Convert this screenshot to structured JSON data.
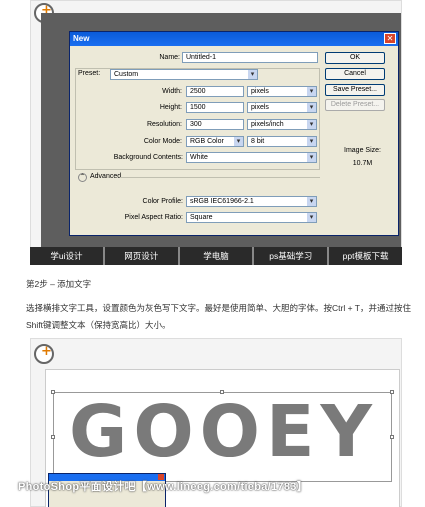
{
  "dialog": {
    "title": "New",
    "name_label": "Name:",
    "name_value": "Untitled-1",
    "preset_label": "Preset:",
    "preset_value": "Custom",
    "width_label": "Width:",
    "width_value": "2500",
    "width_unit": "pixels",
    "height_label": "Height:",
    "height_value": "1500",
    "height_unit": "pixels",
    "resolution_label": "Resolution:",
    "resolution_value": "300",
    "resolution_unit": "pixels/inch",
    "color_mode_label": "Color Mode:",
    "color_mode_value": "RGB Color",
    "bit_depth_value": "8 bit",
    "background_label": "Background Contents:",
    "background_value": "White",
    "advanced_label": "Advanced",
    "color_profile_label": "Color Profile:",
    "color_profile_value": "sRGB IEC61966-2.1",
    "pixel_aspect_label": "Pixel Aspect Ratio:",
    "pixel_aspect_value": "Square",
    "ok_label": "OK",
    "cancel_label": "Cancel",
    "save_preset_label": "Save Preset...",
    "delete_preset_label": "Delete Preset...",
    "image_size_label": "Image Size:",
    "image_size_value": "10.7M"
  },
  "navbar": {
    "items": [
      "学ui设计",
      "网页设计",
      "学电脑",
      "ps基础学习",
      "ppt模板下载"
    ]
  },
  "article": {
    "step": "第2步 – 添加文字",
    "paragraph": "选择横排文字工具，设置颜色为灰色写下文字。最好是使用简单、大胆的字体。按Ctrl + T，并通过按住Shift键调整文本（保持宽高比）大小。"
  },
  "canvas_text": "GOOEY",
  "watermark": "PhotoShop平面设计吧【www.lineeg.com/tieba/1783】"
}
